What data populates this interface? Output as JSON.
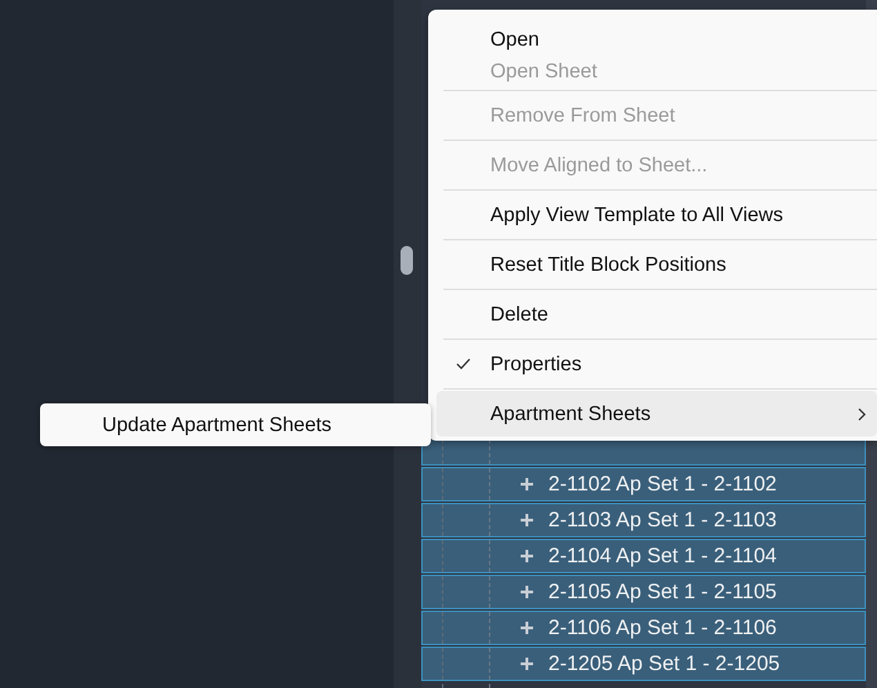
{
  "tree": {
    "rows": [
      {
        "selected": true
      },
      {
        "label": "2-1102 Ap Set 1 - 2-1102",
        "selected": true
      },
      {
        "label": "2-1103 Ap Set 1 - 2-1103",
        "selected": true
      },
      {
        "label": "2-1104 Ap Set 1 - 2-1104",
        "selected": true
      },
      {
        "label": "2-1105 Ap Set 1 - 2-1105",
        "selected": true
      },
      {
        "label": "2-1106 Ap Set 1 - 2-1106",
        "selected": true
      },
      {
        "label": "2-1205 Ap Set 1 - 2-1205",
        "selected": true
      },
      {
        "selected": false
      }
    ]
  },
  "context_menu": {
    "items": [
      {
        "kind": "item",
        "label": "Open",
        "disabled": false,
        "checked": false,
        "selected": false,
        "submenu": false
      },
      {
        "kind": "item",
        "label": "Open Sheet",
        "disabled": true,
        "checked": false,
        "selected": false,
        "submenu": false
      },
      {
        "kind": "separator"
      },
      {
        "kind": "item",
        "label": "Remove From Sheet",
        "disabled": true,
        "checked": false,
        "selected": false,
        "submenu": false
      },
      {
        "kind": "separator"
      },
      {
        "kind": "item",
        "label": "Move Aligned to Sheet...",
        "disabled": true,
        "checked": false,
        "selected": false,
        "submenu": false
      },
      {
        "kind": "separator"
      },
      {
        "kind": "item",
        "label": "Apply View Template to All Views",
        "disabled": false,
        "checked": false,
        "selected": false,
        "submenu": false
      },
      {
        "kind": "separator"
      },
      {
        "kind": "item",
        "label": "Reset Title Block Positions",
        "disabled": false,
        "checked": false,
        "selected": false,
        "submenu": false
      },
      {
        "kind": "separator"
      },
      {
        "kind": "item",
        "label": "Delete",
        "disabled": false,
        "checked": false,
        "selected": false,
        "submenu": false
      },
      {
        "kind": "separator"
      },
      {
        "kind": "item",
        "label": "Properties",
        "disabled": false,
        "checked": true,
        "selected": false,
        "submenu": false
      },
      {
        "kind": "separator"
      },
      {
        "kind": "item",
        "label": "Apartment Sheets",
        "disabled": false,
        "checked": false,
        "selected": true,
        "submenu": true
      }
    ]
  },
  "submenu": {
    "items": [
      {
        "label": "Update Apartment Sheets"
      }
    ]
  }
}
